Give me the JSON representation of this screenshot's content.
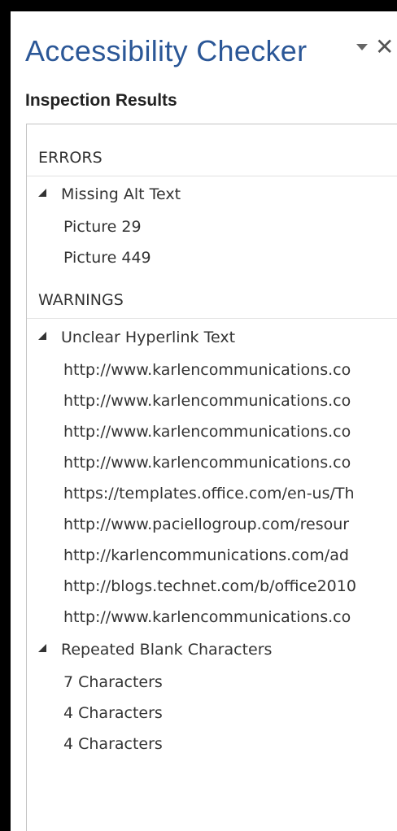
{
  "pane": {
    "title": "Accessibility Checker",
    "dropdown_icon": "caret-down-icon",
    "close_label": "✕"
  },
  "results": {
    "heading": "Inspection Results",
    "errors": {
      "label": "ERRORS",
      "groups": [
        {
          "label": "Missing Alt Text",
          "expanded": true,
          "items": [
            "Picture 29",
            "Picture 449"
          ]
        }
      ]
    },
    "warnings": {
      "label": "WARNINGS",
      "groups": [
        {
          "label": "Unclear Hyperlink Text",
          "expanded": true,
          "items": [
            "http://www.karlencommunications.co",
            "http://www.karlencommunications.co",
            "http://www.karlencommunications.co",
            "http://www.karlencommunications.co",
            "https://templates.office.com/en-us/Th",
            "http://www.paciellogroup.com/resour",
            "http://karlencommunications.com/ad",
            "http://blogs.technet.com/b/office2010",
            "http://www.karlencommunications.co"
          ]
        },
        {
          "label": "Repeated Blank Characters",
          "expanded": true,
          "items": [
            "7 Characters",
            "4 Characters",
            "4 Characters"
          ]
        }
      ]
    }
  },
  "colors": {
    "title": "#2b5797",
    "text": "#333333",
    "border": "#c4c4c4",
    "frame": "#000000"
  }
}
